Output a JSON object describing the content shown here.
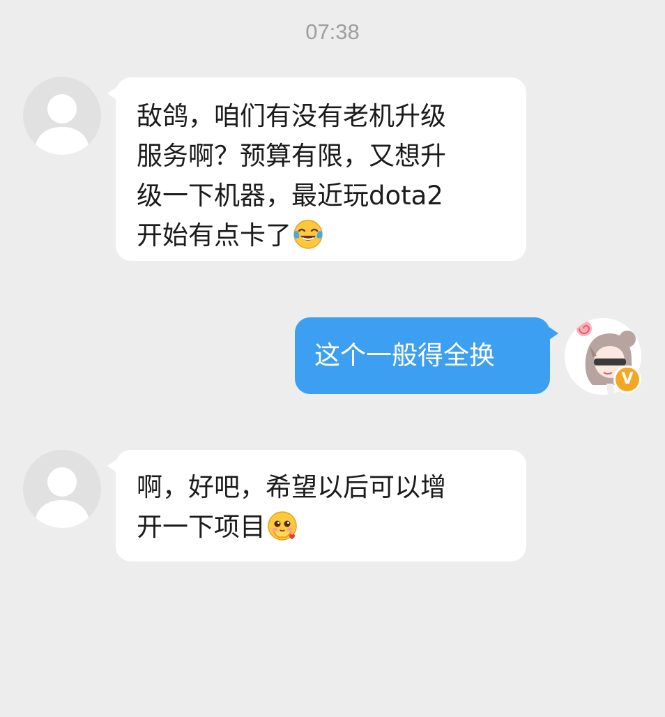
{
  "chat": {
    "timestamp": "07:38",
    "messages": [
      {
        "sender": "other",
        "text": "敌鸽，咱们有没有老机升级\n服务啊？预算有限，又想升\n级一下机器，最近玩dota2\n开始有点卡了",
        "emoji": "laughing-crying-emoji"
      },
      {
        "sender": "me",
        "text": "这个一般得全换"
      },
      {
        "sender": "other",
        "text": "啊，好吧，希望以后可以增\n开一下项目",
        "emoji": "blushing-heart-emoji"
      }
    ],
    "me_badge": "V",
    "colors": {
      "background": "#ededed",
      "incoming_bubble": "#ffffff",
      "outgoing_bubble": "#3d9ff1",
      "badge": "#f5a623"
    }
  }
}
